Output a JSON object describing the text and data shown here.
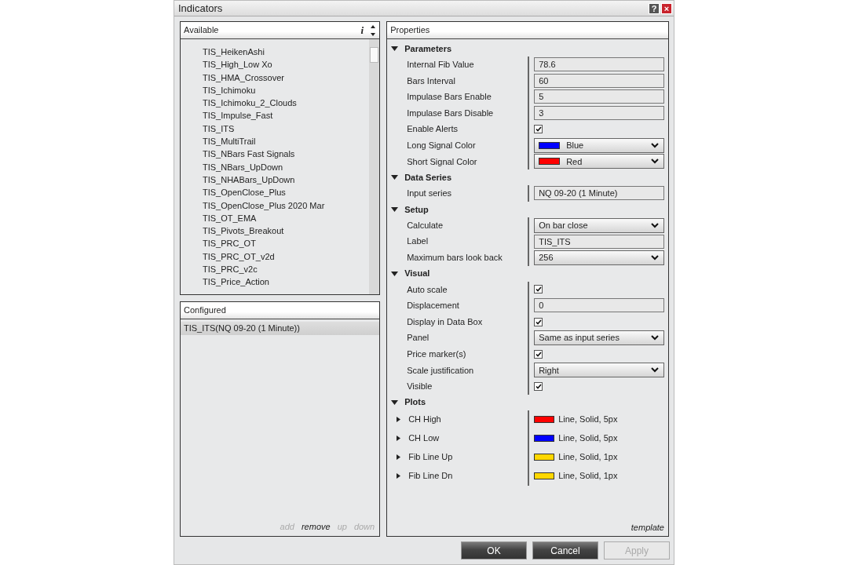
{
  "window": {
    "title": "Indicators",
    "buttons": [
      {
        "kind": "help",
        "label": "?"
      },
      {
        "kind": "close",
        "label": "×"
      }
    ]
  },
  "available": {
    "title": "Available",
    "info": "i",
    "items": [
      "TIS_HeikenAshi",
      "TIS_High_Low Xo",
      "TIS_HMA_Crossover",
      "TIS_Ichimoku",
      "TIS_Ichimoku_2_Clouds",
      "TIS_Impulse_Fast",
      "TIS_ITS",
      "TIS_MultiTrail",
      "TIS_NBars Fast Signals",
      "TIS_NBars_UpDown",
      "TIS_NHABars_UpDown",
      "TIS_OpenClose_Plus",
      "TIS_OpenClose_Plus 2020 Mar",
      "TIS_OT_EMA",
      "TIS_Pivots_Breakout",
      "TIS_PRC_OT",
      "TIS_PRC_OT_v2d",
      "TIS_PRC_v2c",
      "TIS_Price_Action"
    ]
  },
  "configured": {
    "title": "Configured",
    "items": [
      {
        "label": "TIS_ITS(NQ 09-20 (1 Minute))",
        "selected": true
      }
    ],
    "actions": [
      {
        "label": "add",
        "disabled": true
      },
      {
        "label": "remove",
        "disabled": false
      },
      {
        "label": "up",
        "disabled": true
      },
      {
        "label": "down",
        "disabled": true
      }
    ]
  },
  "properties": {
    "title": "Properties",
    "footer": "template",
    "categories": [
      {
        "name": "Parameters",
        "expanded": true,
        "rows": [
          {
            "kind": "text",
            "label": "Internal Fib Value",
            "value": "78.6"
          },
          {
            "kind": "text",
            "label": "Bars Interval",
            "value": "60"
          },
          {
            "kind": "text",
            "label": "Impulase Bars Enable",
            "value": "5"
          },
          {
            "kind": "text",
            "label": "Impulase Bars Disable",
            "value": "3"
          },
          {
            "kind": "check",
            "label": "Enable Alerts",
            "checked": true
          },
          {
            "kind": "color-select",
            "label": "Long Signal Color",
            "value": "Blue",
            "color": "#0000ff"
          },
          {
            "kind": "color-select",
            "label": "Short Signal Color",
            "value": "Red",
            "color": "#ff0000"
          }
        ]
      },
      {
        "name": "Data Series",
        "expanded": true,
        "rows": [
          {
            "kind": "text",
            "label": "Input series",
            "value": "NQ 09-20 (1 Minute)"
          }
        ]
      },
      {
        "name": "Setup",
        "expanded": true,
        "rows": [
          {
            "kind": "select",
            "label": "Calculate",
            "value": "On bar close"
          },
          {
            "kind": "text",
            "label": "Label",
            "value": "TIS_ITS"
          },
          {
            "kind": "select",
            "label": "Maximum bars look back",
            "value": "256"
          }
        ]
      },
      {
        "name": "Visual",
        "expanded": true,
        "rows": [
          {
            "kind": "check",
            "label": "Auto scale",
            "checked": true
          },
          {
            "kind": "text",
            "label": "Displacement",
            "value": "0"
          },
          {
            "kind": "check",
            "label": "Display in Data Box",
            "checked": true
          },
          {
            "kind": "select",
            "label": "Panel",
            "value": "Same as input series"
          },
          {
            "kind": "check",
            "label": "Price marker(s)",
            "checked": true
          },
          {
            "kind": "select",
            "label": "Scale justification",
            "value": "Right"
          },
          {
            "kind": "check",
            "label": "Visible",
            "checked": true
          }
        ]
      },
      {
        "name": "Plots",
        "expanded": true,
        "rows": [
          {
            "kind": "plot",
            "label": "CH High",
            "expanded": false,
            "value": "Line, Solid, 5px",
            "color": "#ff0000"
          },
          {
            "kind": "plot",
            "label": "CH Low",
            "expanded": false,
            "value": "Line, Solid, 5px",
            "color": "#0000ff"
          },
          {
            "kind": "plot",
            "label": "Fib Line Up",
            "expanded": false,
            "value": "Line, Solid, 1px",
            "color": "#ffd700"
          },
          {
            "kind": "plot",
            "label": "Fib Line Dn",
            "expanded": false,
            "value": "Line, Solid, 1px",
            "color": "#ffd700"
          }
        ]
      }
    ]
  },
  "buttons": [
    {
      "label": "OK",
      "disabled": false
    },
    {
      "label": "Cancel",
      "disabled": false
    },
    {
      "label": "Apply",
      "disabled": true
    }
  ]
}
